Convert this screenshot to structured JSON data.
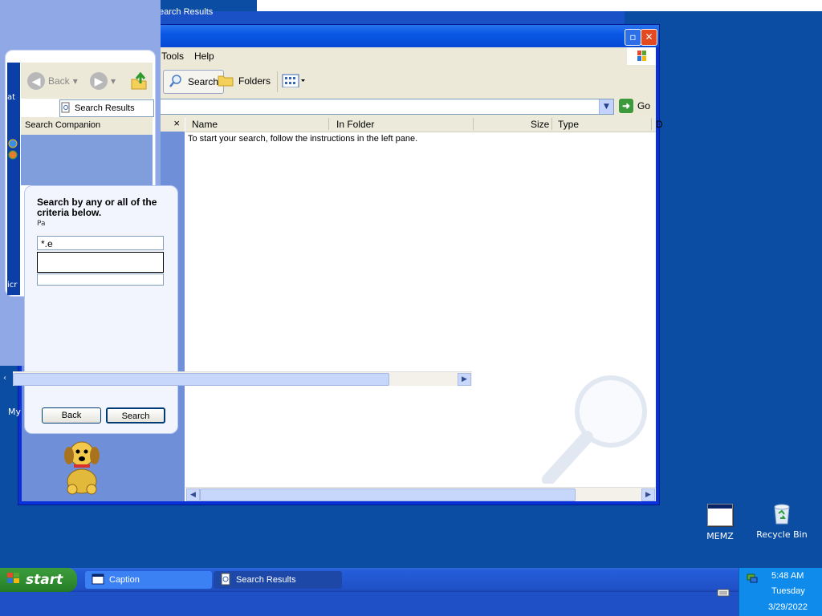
{
  "desktop": {
    "icons": [
      {
        "label": "MEMZ"
      },
      {
        "label": "Recycle Bin"
      }
    ],
    "background_color": "#0b4da2"
  },
  "explorer": {
    "menu": [
      "Tools",
      "Help"
    ],
    "toolbar": {
      "back_label": "Back",
      "search_label": "Search",
      "folders_label": "Folders"
    },
    "address": {
      "go_label": "Go"
    },
    "columns": [
      "Name",
      "In Folder",
      "Size",
      "Type",
      "D"
    ],
    "empty_message": "To start your search, follow the instructions in the left pane."
  },
  "companion": {
    "tab_label": "Search Results",
    "header_title": "Search Companion",
    "close_glyph": "×",
    "criteria_text": "Search by any or all of the criteria below.",
    "partial_label": "Pa",
    "search_value": "*.e",
    "back_button": "Back",
    "search_button": "Search"
  },
  "ghost": {
    "window_title_fragment": "earch Results",
    "strip_letters": [
      "at",
      "icr"
    ],
    "left_label": "My"
  },
  "taskbar": {
    "start_label": "start",
    "tasks": [
      {
        "label": "Caption"
      },
      {
        "label": "Search Results"
      }
    ],
    "clock": {
      "time": "5:48 AM",
      "day": "Tuesday",
      "date": "3/29/2022"
    }
  }
}
